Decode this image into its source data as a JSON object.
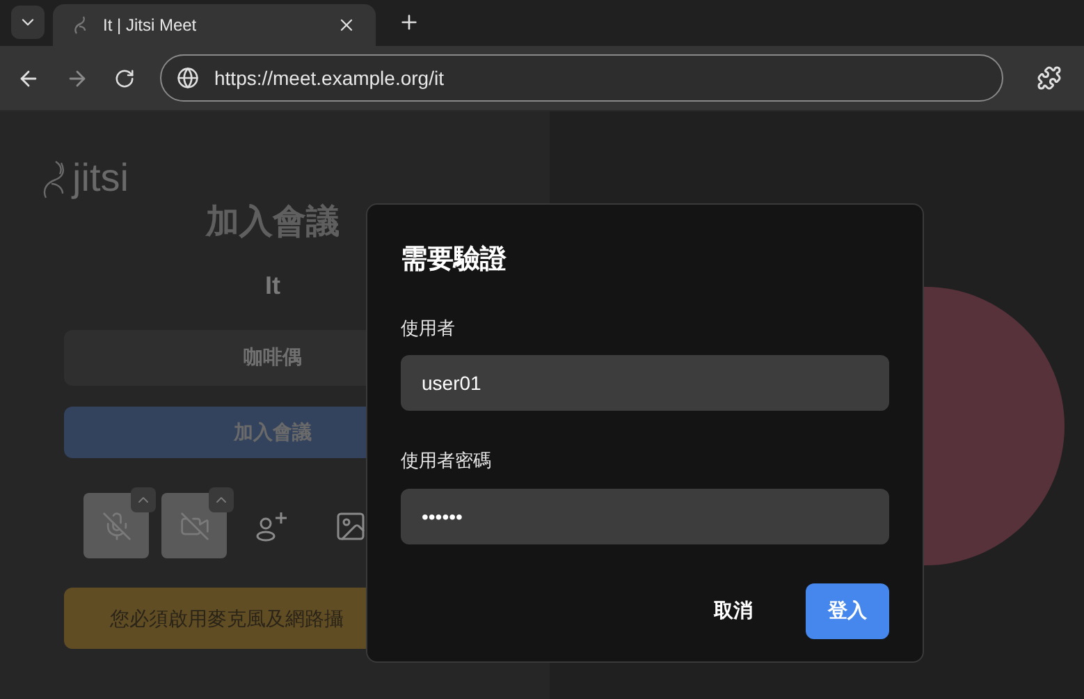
{
  "browser": {
    "tabs": [
      {
        "title": "It | Jitsi Meet",
        "selected": true
      }
    ],
    "url": "https://meet.example.org/it"
  },
  "prejoin": {
    "logo": "jitsi",
    "title": "加入會議",
    "meeting_name": "It",
    "name_field": {
      "value": "咖啡偶"
    },
    "join_button": "加入會議",
    "media_buttons": [
      {
        "kind": "mic",
        "enabled": false
      },
      {
        "kind": "camera",
        "enabled": false
      },
      {
        "kind": "invite"
      },
      {
        "kind": "background"
      }
    ],
    "warning": "您必須啟用麥克風及網路攝"
  },
  "dialog": {
    "title": "需要驗證",
    "fields": [
      {
        "label": "使用者",
        "value": "user01"
      },
      {
        "label": "使用者密碼",
        "value": "••••••"
      }
    ],
    "buttons": [
      {
        "label": "取消",
        "kind": "secondary"
      },
      {
        "label": "登入",
        "kind": "primary"
      }
    ]
  }
}
